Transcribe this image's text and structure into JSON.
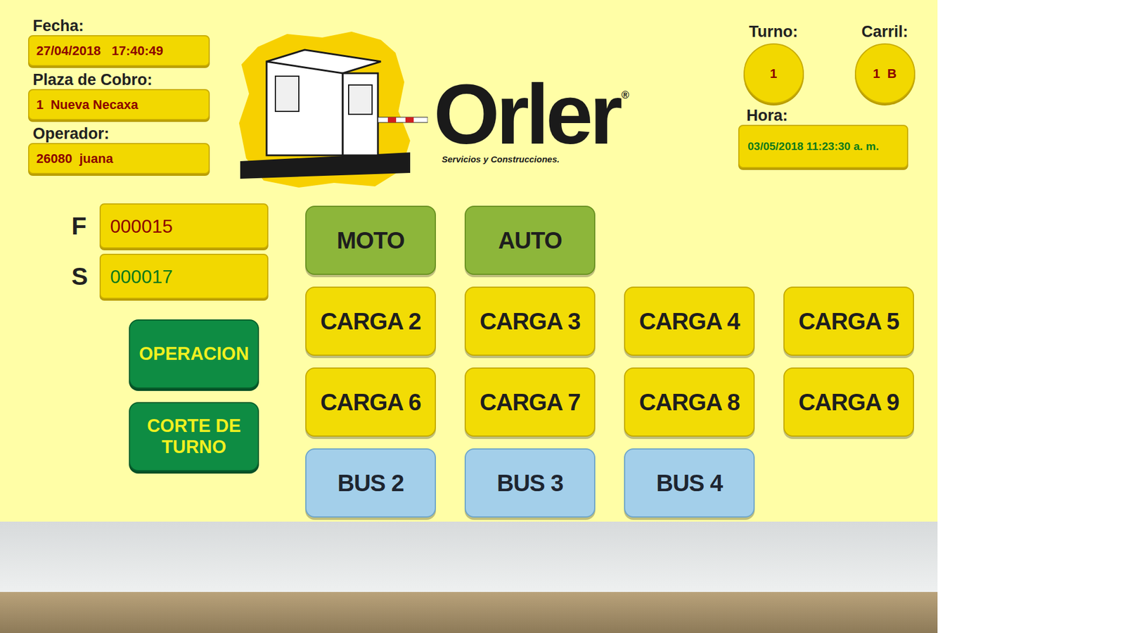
{
  "fields": [
    {
      "label": "Fecha:",
      "value": "27/04/2018   17:40:49"
    },
    {
      "label": "Plaza de Cobro:",
      "value": "1  Nueva Necaxa"
    },
    {
      "label": "Operador:",
      "value": "26080  juana"
    }
  ],
  "logo": {
    "name": "Orler",
    "mark": "®",
    "tagline": "Servicios y Construcciones."
  },
  "turno": {
    "label": "Turno:",
    "value": "1"
  },
  "carril": {
    "label": "Carril:",
    "value": "1  B"
  },
  "hora": {
    "label": "Hora:",
    "value": "03/05/2018 11:23:30 a. m."
  },
  "counters": [
    {
      "label": "F",
      "value": "000015",
      "color": "#8b0000"
    },
    {
      "label": "S",
      "value": "000017",
      "color": "#0a7a1a"
    }
  ],
  "actions": [
    "OPERACION",
    "CORTE DE TURNO"
  ],
  "vehicle_rows": [
    [
      {
        "label": "MOTO",
        "kind": "light"
      },
      {
        "label": "AUTO",
        "kind": "light"
      }
    ],
    [
      {
        "label": "CARGA 2",
        "kind": "cargo"
      },
      {
        "label": "CARGA 3",
        "kind": "cargo"
      },
      {
        "label": "CARGA 4",
        "kind": "cargo"
      },
      {
        "label": "CARGA 5",
        "kind": "cargo"
      }
    ],
    [
      {
        "label": "CARGA 6",
        "kind": "cargo"
      },
      {
        "label": "CARGA 7",
        "kind": "cargo"
      },
      {
        "label": "CARGA 8",
        "kind": "cargo"
      },
      {
        "label": "CARGA 9",
        "kind": "cargo"
      }
    ],
    [
      {
        "label": "BUS 2",
        "kind": "bus"
      },
      {
        "label": "BUS 3",
        "kind": "bus"
      },
      {
        "label": "BUS 4",
        "kind": "bus"
      }
    ]
  ]
}
